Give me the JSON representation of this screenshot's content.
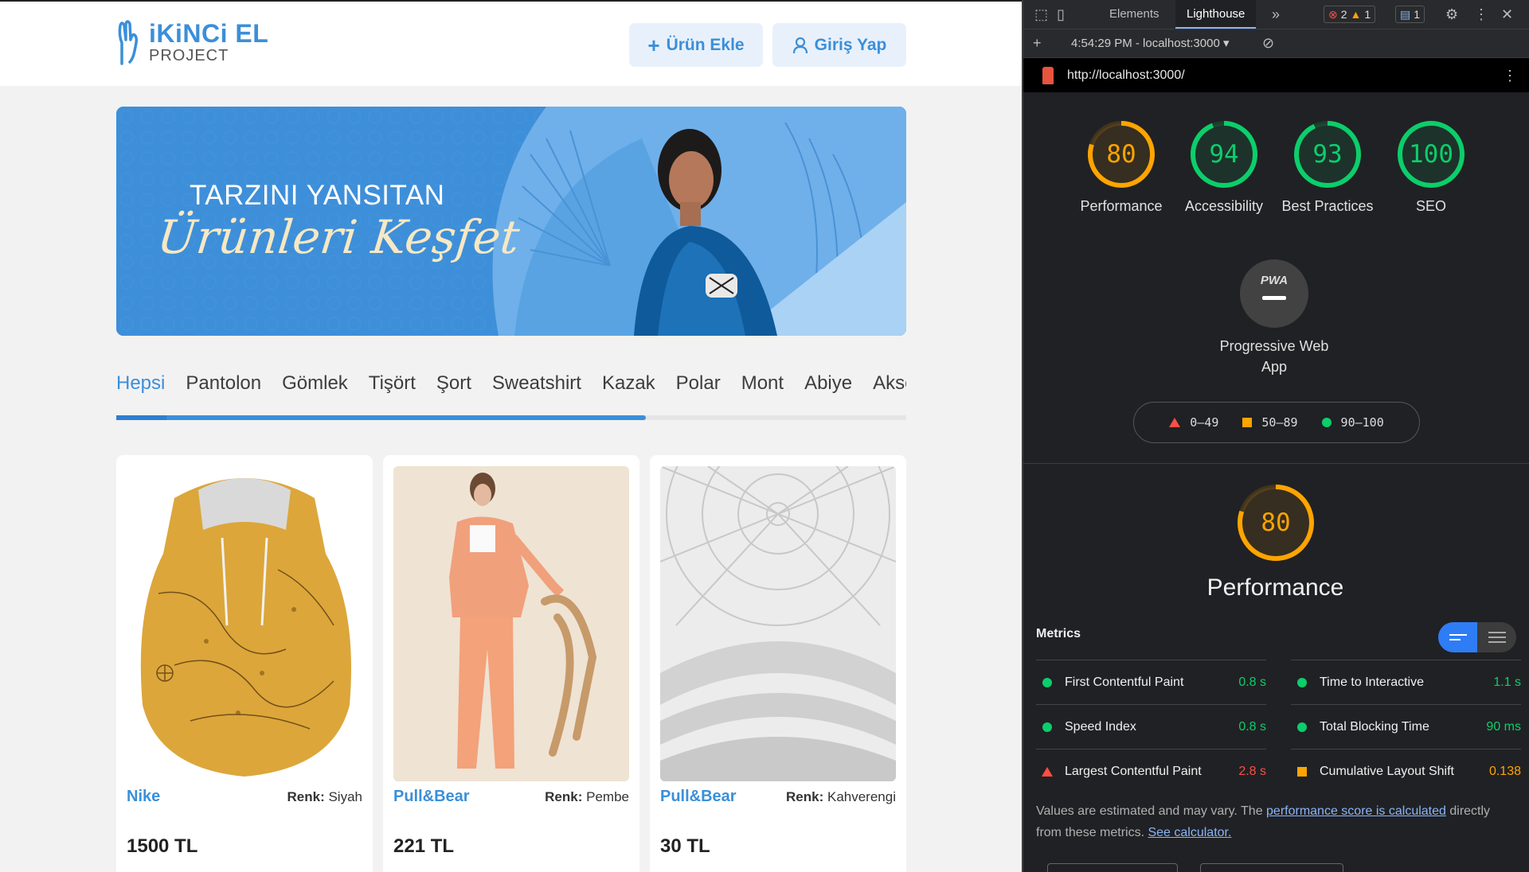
{
  "app": {
    "logo": {
      "line1": "iKiNCi EL",
      "line2": "PROJECT"
    },
    "header": {
      "add_product": "Ürün Ekle",
      "login": "Giriş Yap"
    },
    "banner": {
      "line1": "TARZINI YANSITAN",
      "line2": "Ürünleri Keşfet"
    },
    "categories": [
      "Hepsi",
      "Pantolon",
      "Gömlek",
      "Tişört",
      "Şort",
      "Sweatshirt",
      "Kazak",
      "Polar",
      "Mont",
      "Abiye",
      "Aksesuar"
    ],
    "category_scroll_fraction": 0.67,
    "color_label": "Renk:",
    "products": [
      {
        "brand": "Nike",
        "color": "Siyah",
        "price": "1500 TL"
      },
      {
        "brand": "Pull&Bear",
        "color": "Pembe",
        "price": "221 TL"
      },
      {
        "brand": "Pull&Bear",
        "color": "Kahverengi",
        "price": "30 TL"
      }
    ]
  },
  "devtools": {
    "tabs": {
      "elements": "Elements",
      "lighthouse": "Lighthouse"
    },
    "badges": {
      "errors": "2",
      "warnings": "1",
      "messages": "1"
    },
    "run_label": "4:54:29 PM - localhost:3000",
    "url": "http://localhost:3000/",
    "scores": [
      {
        "label": "Performance",
        "score": 80,
        "color": "#ffa400"
      },
      {
        "label": "Accessibility",
        "score": 94,
        "color": "#0cce6b"
      },
      {
        "label": "Best Practices",
        "score": 93,
        "color": "#0cce6b"
      },
      {
        "label": "SEO",
        "score": 100,
        "color": "#0cce6b"
      }
    ],
    "pwa": {
      "badge": "PWA",
      "label": "Progressive Web App"
    },
    "legend": {
      "fail": "0–49",
      "average": "50–89",
      "pass": "90–100"
    },
    "performance": {
      "score": 80,
      "title": "Performance"
    },
    "metrics_heading": "Metrics",
    "metrics": [
      {
        "name": "First Contentful Paint",
        "value": "0.8 s",
        "status": "pass"
      },
      {
        "name": "Time to Interactive",
        "value": "1.1 s",
        "status": "pass"
      },
      {
        "name": "Speed Index",
        "value": "0.8 s",
        "status": "pass"
      },
      {
        "name": "Total Blocking Time",
        "value": "90 ms",
        "status": "pass"
      },
      {
        "name": "Largest Contentful Paint",
        "value": "2.8 s",
        "status": "fail"
      },
      {
        "name": "Cumulative Layout Shift",
        "value": "0.138",
        "status": "average"
      }
    ],
    "disclaimer": {
      "prefix": "Values are estimated and may vary. The ",
      "link1": "performance score is calculated",
      "middle": " directly from these metrics. ",
      "link2": "See calculator."
    },
    "colors": {
      "pass": "#0cce6b",
      "average": "#ffa400",
      "fail": "#ff4e42"
    }
  }
}
